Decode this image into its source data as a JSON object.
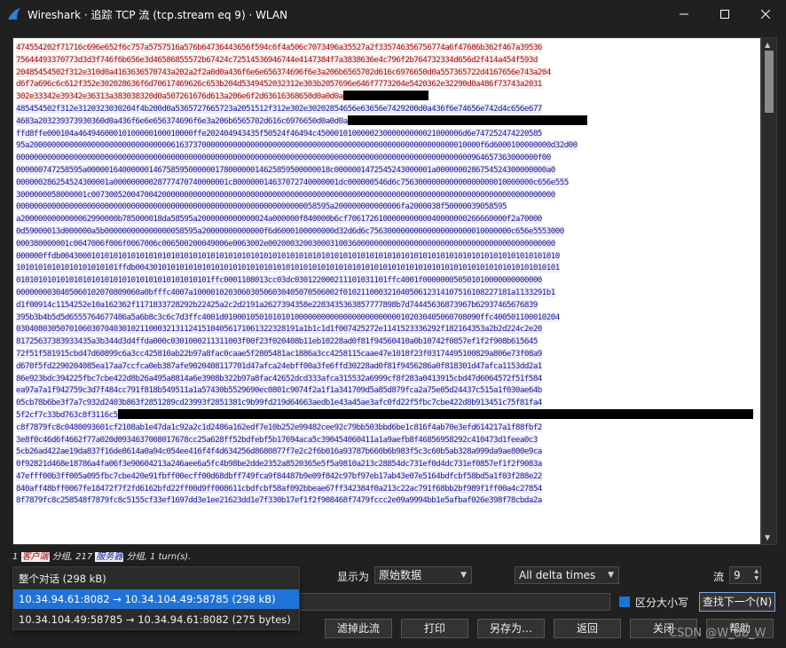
{
  "window": {
    "title": "Wireshark · 追踪 TCP 流 (tcp.stream eq 9) · WLAN"
  },
  "stream": {
    "lines": [
      {
        "dir": "client",
        "text": "474554202f71716c696e652f6c757a5757516a576b64736443656f594c6f4a506c7073496a35527a2f335746356756774a6f47686b362f467a39536"
      },
      {
        "dir": "client",
        "text": "75644493370773d3d3f746f6b656e3d46586855572b67424c72514536946744e4147384f7a3838636e4c796f2b764732334d656d2f414a454f593d"
      },
      {
        "dir": "client",
        "text": "20485454502f312e310d0a4163636570743a202a2f2a0d0a436f6e6e656374696f6e3a206b6565702d616c6976650d0a557365722d4167656e743a204"
      },
      {
        "dir": "client",
        "text": "d6f7a696c6c612f352e302028636f6d70617469626c653b204d5349452032312e303b2057696e646f7773204e5420362e32290d0a486f73743a2031"
      },
      {
        "dir": "client",
        "text": "302e33342e39342e36313a383038320d0a507261676d613a206e6f2d63616368650d0a0d0a",
        "tail": 96
      },
      {
        "dir": "server",
        "text": "485454502f312e3120323030204f4b200d0a5365727665723a2051512f312e302e30202854656e63656e7429200d0a436f6e74656e742d4c656e677"
      },
      {
        "dir": "server",
        "text": "4683a203239373930360d0a436f6e6e656374696f6e3a206b6565702d616c6976650d0a0d0a",
        "tail": 270
      },
      {
        "dir": "server",
        "text": "ffd8ffe000104a46494600010100000100010000ffe202404943435f50524f46494c450001010000023000000000021000006d6e747252474220585"
      },
      {
        "dir": "server",
        "text": "95a200000000000000000000000000000006163737000000000000000000000000000000000000000000000000000000000010000f6d6000100000000d32d00"
      },
      {
        "dir": "server",
        "text": "0000000000000000000000000000000000000000000000000000000000000000000000000000000000000000000000000000000964657363000000f00"
      },
      {
        "dir": "server",
        "text": "000000747258595a0000016400000014675859500000017800000014625859500000018c0000001472545243000001a0000000286754524300000000a0"
      },
      {
        "dir": "server",
        "text": "000000286254524300001a00000000028777470740000001c800000014637072740000001dc000000546d6c756300000000000000000010000000c656e555"
      },
      {
        "dir": "server",
        "text": "3000000058000001c007300520047004200000000000000000000000000000000000000000000000000000000000000000000000000000000000000000"
      },
      {
        "dir": "server",
        "text": "00000000000000000000000000000000000000000000000000000000000000000058595a200000000000006fa2000038f50000039058595"
      },
      {
        "dir": "server",
        "text": "a2000000000000062990000b785000018da58595a2000000000000024a000000f840000b6cf706172610000000000040000000266660000f2a70000"
      },
      {
        "dir": "server",
        "text": "0d59000013d000000a5b000000000000000058595a20000000000000f6d6000100000000d32d6d6c75630000000000000000000010000000c656e5553000"
      },
      {
        "dir": "server",
        "text": "000380000001c0047006f006f0067006c006500200049006e0063002e00200032003000310036000000000000000000000000000000000000000000000"
      },
      {
        "dir": "server",
        "text": "000000ffdb00430001010101010101010101010101010101010101010101010101010101010101010101010101010101010101010101010101010101010"
      },
      {
        "dir": "server",
        "text": "10101010101010101010101ffdb004301010101010101010101010101010101010101010101010101010101010101010101010101010101010101010101"
      },
      {
        "dir": "server",
        "text": "01010101010101010101010101010101010101010101ffc0001108013cc03dc030122000211101031101ffc4001f000000050501010000000000000"
      },
      {
        "dir": "server",
        "text": "0000000030405060102070809060a0bfffc4007a100001020306030506030405070506002f01021100032104050612314107516108227181a1133291b1"
      },
      {
        "dir": "server",
        "text": "d1f00914c1154252e10a162362f1171833728292b22425a2c2d2191a2627394358e2283435363857777898b7d74445636873967b62937465676839"
      },
      {
        "dir": "server",
        "text": "395b3b4b5d5d6555764677486a5a6b8c3c6c7d3ffc4001d0100010501010101000000000000000000000000102030405060708090ffc400501100010204"
      },
      {
        "dir": "server",
        "text": "0304080305070106030704030102110003213112415104056171061322328191a1b1c1d1f007425272e1141523336292f182164353a2b2d224c2e20"
      },
      {
        "dir": "server",
        "text": "81725637383933435a3b344d3d4ffda000c0301000211311003f00f23f020408b11eb10228ad0f81f94560410a0b10742f0857ef1f2f908b615645"
      },
      {
        "dir": "server",
        "text": "72f51f581915cbd47d60899c6a3cc425810ab22b97a8fac0caae5f2805481ac1886a3cc4258115caae47e1018f23f03174495100829a806e73f08a9"
      },
      {
        "dir": "server",
        "text": "d670f5fd2290204085ea17aa7ccfca0eb387afe9020408117701d47afca24ebff00a3fe6ffd30228ad0f81f9456286a0f818301d47afca1153dd2a1"
      },
      {
        "dir": "server",
        "text": "86e923bdc394225fbc7cbe422d8b26a495a8814a6e3908b322b97a8fac42652dcd333afca315532a6999cf8f283a0413915cbd47d6064572f51f584"
      },
      {
        "dir": "server",
        "text": "ea97a7a1f942759c3d7f484cc791f818b549511a1a57430b5529690ec0801c9074f2a1f1a341709d5a85d879fca2a75e05d24437c515a1f030ae64b"
      },
      {
        "dir": "server",
        "text": "05cb78b6be3f7a7c932d2403b863f2851289cd23993f2851381c9b99fd219d64663aedb1e43a45ae3afc0fd22f5fbc7cbe422d8b913451c75f81fa4"
      },
      {
        "dir": "server",
        "text": "5f2cf7c33bd763c8f3116c5",
        "tail": 716
      },
      {
        "dir": "server",
        "text": "c8f7879fc8c0480093601cf2108ab1e47da1c92a2c1d2486a162edf7e10b252e99482cee92c79bb503bbd6be1c816f4ab70e3efd614217a1f88fbf2"
      },
      {
        "dir": "server",
        "text": "3e8f0c46d6f4662f77a020d0934637008017678cc25a628ff52bdfebf5b17694aca5c390454060411a1a9aefb8f46856958292c410473d1feea0c3"
      },
      {
        "dir": "server",
        "text": "5cb26ad422ae19da837f16de8614a0a94c054ee416f4f4d634256d8680877f7e2c2f6b016a93787b660b6b983f5c3c60b5ab328a999da9ae800e9ca"
      },
      {
        "dir": "server",
        "text": "0f92821d468e18786a4fa06f3e90604213a246aee6a5fc4b98be2dde2352a8520365e5f5a9810a213c28854dc731ef0d4dc731ef0857ef1f2f9083a"
      },
      {
        "dir": "server",
        "text": "47efff00b3ff005a095fbc7cbe420e91fbff00ecff00d68dbff749fca9f84487b9e09f842c97bf97eb17ab43e07e5164bdfcbf58bd5a1f03f288e22"
      },
      {
        "dir": "server",
        "text": "840aff48bff0067fe18472f7f2fd6162bfd22ff00d9ff008611cbdfcbf58af092bbeae67ff342384f0a213c22ac791f68bb2bf989f1ff00a4c27854"
      },
      {
        "dir": "server",
        "text": "8f7879fc8c258548f7879fc8c5155cf33ef1697dd3e1ee21623dd1e7f330b17ef1f2f908468f7479fccc2e09a9994bb1e5afbaf026e398f78cbda2a"
      }
    ]
  },
  "status": {
    "count_client": "1",
    "client_label": "客户端",
    "unit1": " 分组, ",
    "count_server": "217",
    "server_label": "服务器",
    "unit2": " 分组, ",
    "turns": "1 turn(s)."
  },
  "dropdown": {
    "items": [
      "整个对话 (298 kB)",
      "10.34.94.61:8082 → 10.34.104.49:58785 (298 kB)",
      "10.34.104.49:58785 → 10.34.94.61:8082 (275 bytes)"
    ],
    "selected_index": 1
  },
  "controls": {
    "show_as_label": "显示为",
    "show_as_value": "原始数据",
    "delta_value": "All delta times",
    "stream_label": "流",
    "stream_value": "9",
    "case_label": "区分大小写",
    "find_next": "查找下一个(N)",
    "filter_out": "滤掉此流",
    "print": "打印",
    "save_as": "另存为…",
    "back": "返回",
    "close": "关闭",
    "help": "帮助"
  },
  "watermark": "CSDN @W_db_W",
  "colors": {
    "client_fg": "#9c0d0d",
    "client_bg": "#fbeded",
    "server_fg": "#1c1c8a",
    "server_bg": "#ededfb",
    "accent": "#1f72d6"
  }
}
